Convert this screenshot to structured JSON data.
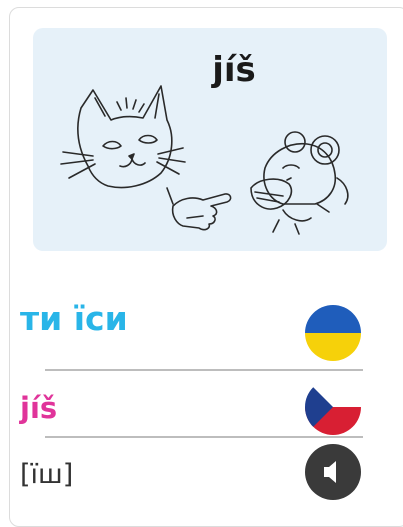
{
  "illustration": {
    "word": "jíš",
    "background_color": "#e6f1f9",
    "icons": [
      "cat-drawing",
      "pointing-hand-icon",
      "mouse-eating-drawing"
    ]
  },
  "translation": {
    "ukrainian_text": "ти їси",
    "ukrainian_color": "#29b5e8",
    "ukrainian_flag": "ukraine-flag-icon",
    "czech_text": "jíš",
    "czech_color": "#e0349a",
    "czech_flag": "czech-flag-icon",
    "pronunciation": "[їш]",
    "sound_icon": "speaker-icon"
  }
}
